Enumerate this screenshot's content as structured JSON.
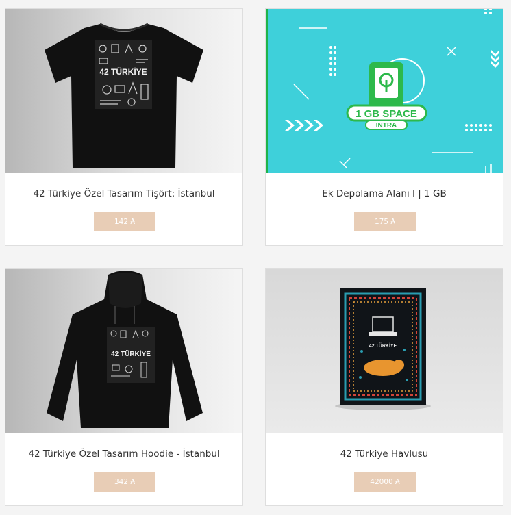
{
  "products": [
    {
      "title": "42 Türkiye Özel Tasarım Tişört: İstanbul",
      "price": "142 ₳",
      "image": "black-tshirt-istanbul-print"
    },
    {
      "title": "Ek Depolama Alanı I | 1 GB",
      "price": "175 ₳",
      "image": "storage-1gb-banner",
      "banner": {
        "line1": "1 GB SPACE",
        "line2": "INTRA"
      }
    },
    {
      "title": "42 Türkiye Özel Tasarım Hoodie - İstanbul",
      "price": "342 ₳",
      "image": "black-hoodie-istanbul-print"
    },
    {
      "title": "42 Türkiye Havlusu",
      "price": "42000 ₳",
      "image": "towel-cat-print"
    }
  ],
  "colors": {
    "price_bg": "#e8cdb6",
    "banner_bg": "#3ed0da",
    "banner_green": "#2db94b"
  }
}
